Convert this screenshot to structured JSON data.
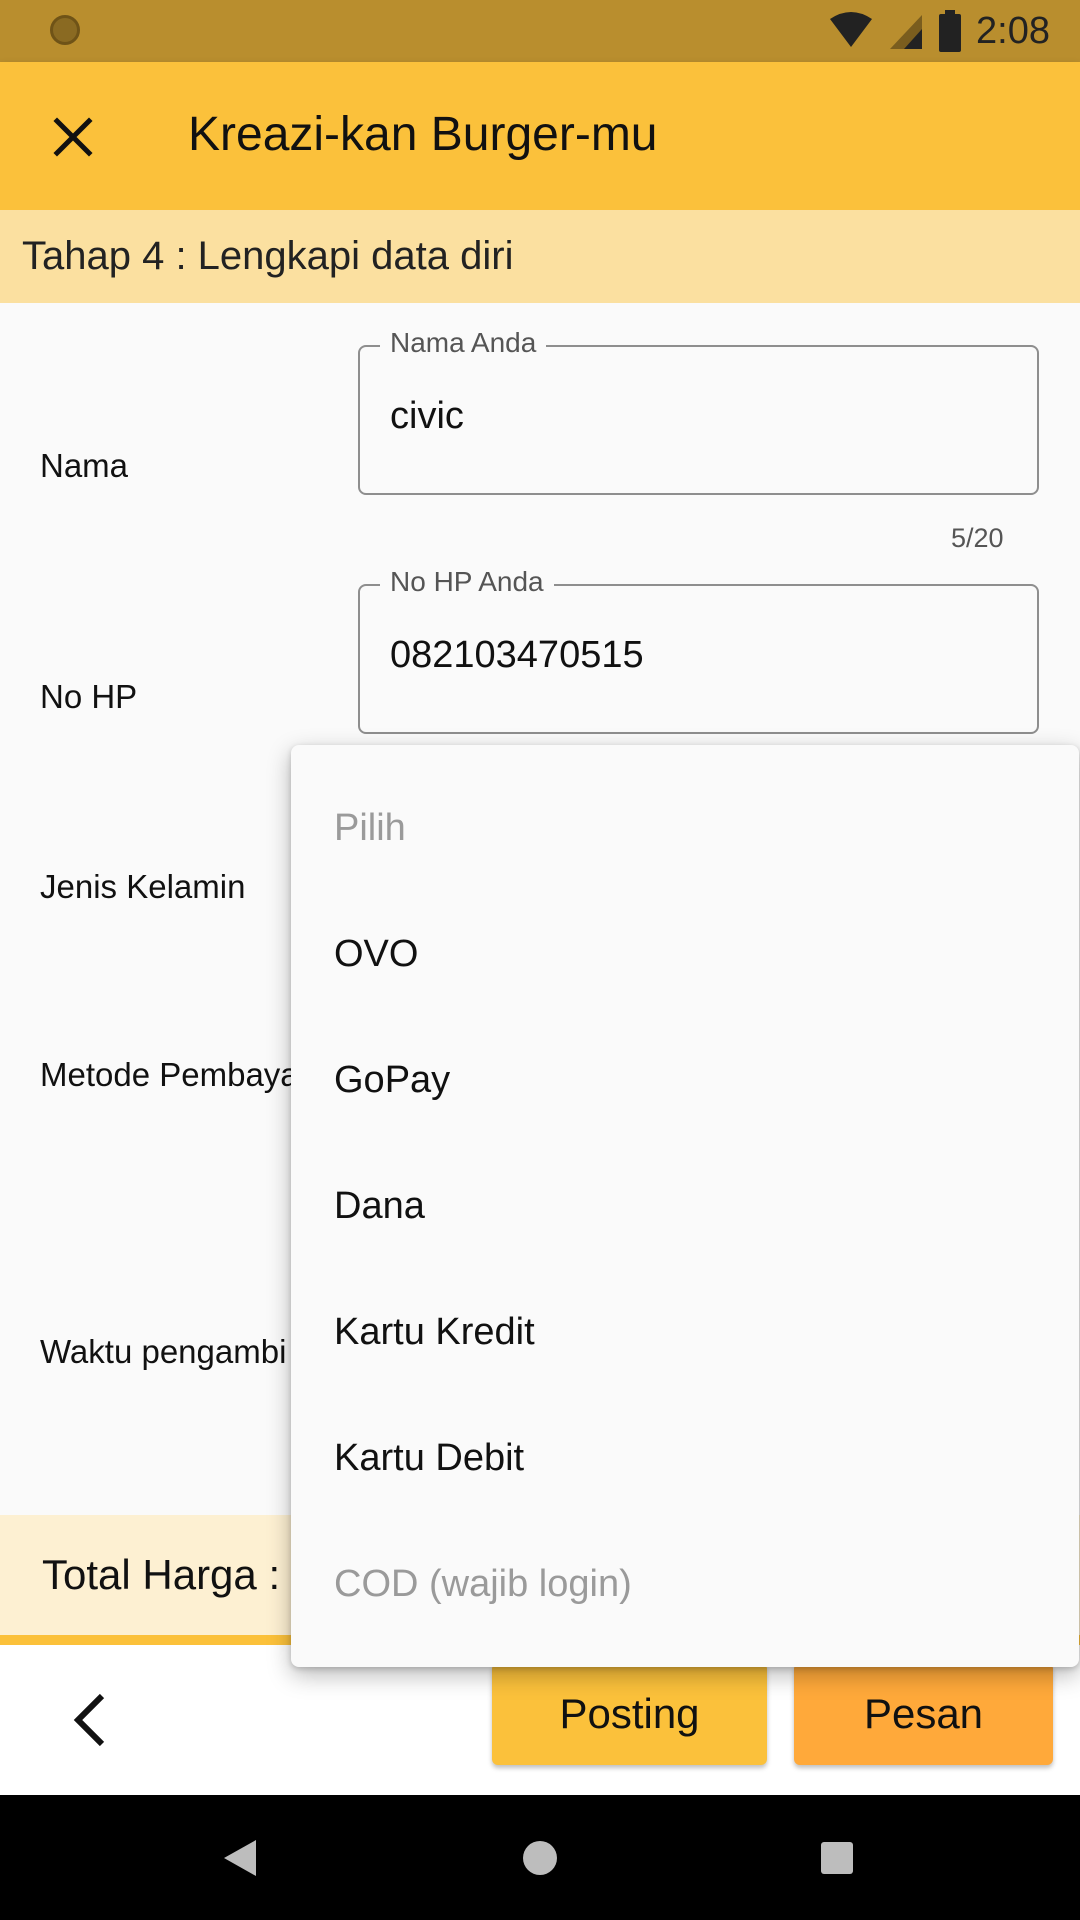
{
  "status_bar": {
    "time": "2:08"
  },
  "app_bar": {
    "title": "Kreazi-kan Burger-mu"
  },
  "step": {
    "text": "Tahap 4 : Lengkapi data diri"
  },
  "form": {
    "name_label": "Nama",
    "name_field": {
      "legend": "Nama Anda",
      "value": "civic",
      "counter": "5/20"
    },
    "phone_label": "No HP",
    "phone_field": {
      "legend": "No HP Anda",
      "value": "082103470515"
    },
    "gender_label": "Jenis Kelamin",
    "payment_label": "Metode Pembaya",
    "pickup_label": "Waktu pengambi"
  },
  "dropdown": {
    "options": [
      {
        "label": "Pilih",
        "enabled": false
      },
      {
        "label": "OVO",
        "enabled": true
      },
      {
        "label": "GoPay",
        "enabled": true
      },
      {
        "label": "Dana",
        "enabled": true
      },
      {
        "label": "Kartu Kredit",
        "enabled": true
      },
      {
        "label": "Kartu Debit",
        "enabled": true
      },
      {
        "label": "COD (wajib login)",
        "enabled": false
      }
    ]
  },
  "total": {
    "label": "Total Harga :"
  },
  "actions": {
    "posting": "Posting",
    "pesan": "Pesan"
  },
  "colors": {
    "status_bar": "#b98e2e",
    "app_bar": "#fbc13b",
    "step_bar": "#fbe0a0",
    "posting_button": "#fbc13b",
    "pesan_button": "#ffa93a"
  }
}
